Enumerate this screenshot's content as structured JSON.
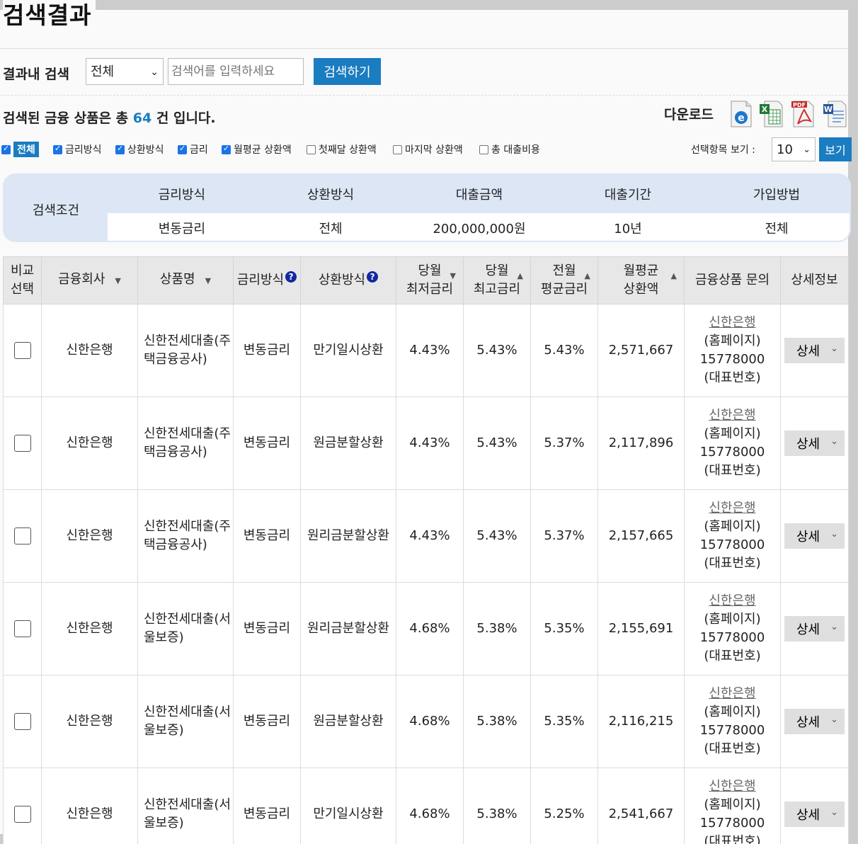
{
  "title": "검색결과",
  "search": {
    "label": "결과내 검색",
    "select_value": "전체",
    "placeholder": "검색어를 입력하세요",
    "button": "검색하기"
  },
  "summary": {
    "prefix": "검색된 금융 상품은 총",
    "count": "64",
    "suffix": "건 입니다."
  },
  "download": {
    "label": "다운로드",
    "icons": [
      "ie-icon",
      "excel-icon",
      "pdf-icon",
      "word-icon"
    ]
  },
  "filters": {
    "all": "전체",
    "items": [
      {
        "label": "금리방식",
        "checked": true
      },
      {
        "label": "상환방식",
        "checked": true
      },
      {
        "label": "금리",
        "checked": true
      },
      {
        "label": "월평균 상환액",
        "checked": true
      },
      {
        "label": "첫째달 상환액",
        "checked": false
      },
      {
        "label": "마지막 상환액",
        "checked": false
      },
      {
        "label": "총 대출비용",
        "checked": false
      }
    ]
  },
  "view": {
    "label": "선택항목 보기 :",
    "value": "10",
    "button": "보기"
  },
  "conditions": {
    "title": "검색조건",
    "headers": [
      "금리방식",
      "상환방식",
      "대출금액",
      "대출기간",
      "가입방법"
    ],
    "values": [
      "변동금리",
      "전체",
      "200,000,000원",
      "10년",
      "전체"
    ]
  },
  "table": {
    "headers": {
      "compare_line1": "비교",
      "compare_line2": "선택",
      "company": "금융회사",
      "product": "상품명",
      "rate_type": "금리방식",
      "repay_type": "상환방식",
      "min_rate_line1": "당월",
      "min_rate_line2": "최저금리",
      "max_rate_line1": "당월",
      "max_rate_line2": "최고금리",
      "avg_rate_line1": "전월",
      "avg_rate_line2": "평균금리",
      "monthly_line1": "월평균",
      "monthly_line2": "상환액",
      "inquiry": "금융상품 문의",
      "detail": "상세정보"
    },
    "help_glyph": "?",
    "rows": [
      {
        "company": "신한은행",
        "product_line1": "신한전세대출(주",
        "product_line2": "택금융공사)",
        "rate_type": "변동금리",
        "repay_type": "만기일시상환",
        "min_rate": "4.43%",
        "max_rate": "5.43%",
        "avg_rate": "5.43%",
        "monthly": "2,571,667",
        "inq_bank": "신한은행",
        "inq_home": "(홈페이지)",
        "inq_phone": "15778000",
        "inq_rep": "(대표번호)",
        "detail": "상세"
      },
      {
        "company": "신한은행",
        "product_line1": "신한전세대출(주",
        "product_line2": "택금융공사)",
        "rate_type": "변동금리",
        "repay_type": "원금분할상환",
        "min_rate": "4.43%",
        "max_rate": "5.43%",
        "avg_rate": "5.37%",
        "monthly": "2,117,896",
        "inq_bank": "신한은행",
        "inq_home": "(홈페이지)",
        "inq_phone": "15778000",
        "inq_rep": "(대표번호)",
        "detail": "상세"
      },
      {
        "company": "신한은행",
        "product_line1": "신한전세대출(주",
        "product_line2": "택금융공사)",
        "rate_type": "변동금리",
        "repay_type": "원리금분할상환",
        "min_rate": "4.43%",
        "max_rate": "5.43%",
        "avg_rate": "5.37%",
        "monthly": "2,157,665",
        "inq_bank": "신한은행",
        "inq_home": "(홈페이지)",
        "inq_phone": "15778000",
        "inq_rep": "(대표번호)",
        "detail": "상세"
      },
      {
        "company": "신한은행",
        "product_line1": "신한전세대출(서",
        "product_line2": "울보증)",
        "rate_type": "변동금리",
        "repay_type": "원리금분할상환",
        "min_rate": "4.68%",
        "max_rate": "5.38%",
        "avg_rate": "5.35%",
        "monthly": "2,155,691",
        "inq_bank": "신한은행",
        "inq_home": "(홈페이지)",
        "inq_phone": "15778000",
        "inq_rep": "(대표번호)",
        "detail": "상세"
      },
      {
        "company": "신한은행",
        "product_line1": "신한전세대출(서",
        "product_line2": "울보증)",
        "rate_type": "변동금리",
        "repay_type": "원금분할상환",
        "min_rate": "4.68%",
        "max_rate": "5.38%",
        "avg_rate": "5.35%",
        "monthly": "2,116,215",
        "inq_bank": "신한은행",
        "inq_home": "(홈페이지)",
        "inq_phone": "15778000",
        "inq_rep": "(대표번호)",
        "detail": "상세"
      },
      {
        "company": "신한은행",
        "product_line1": "신한전세대출(서",
        "product_line2": "울보증)",
        "rate_type": "변동금리",
        "repay_type": "만기일시상환",
        "min_rate": "4.68%",
        "max_rate": "5.38%",
        "avg_rate": "5.25%",
        "monthly": "2,541,667",
        "inq_bank": "신한은행",
        "inq_home": "(홈페이지)",
        "inq_phone": "15778000",
        "inq_rep": "(대표번호)",
        "detail": "상세"
      }
    ]
  }
}
